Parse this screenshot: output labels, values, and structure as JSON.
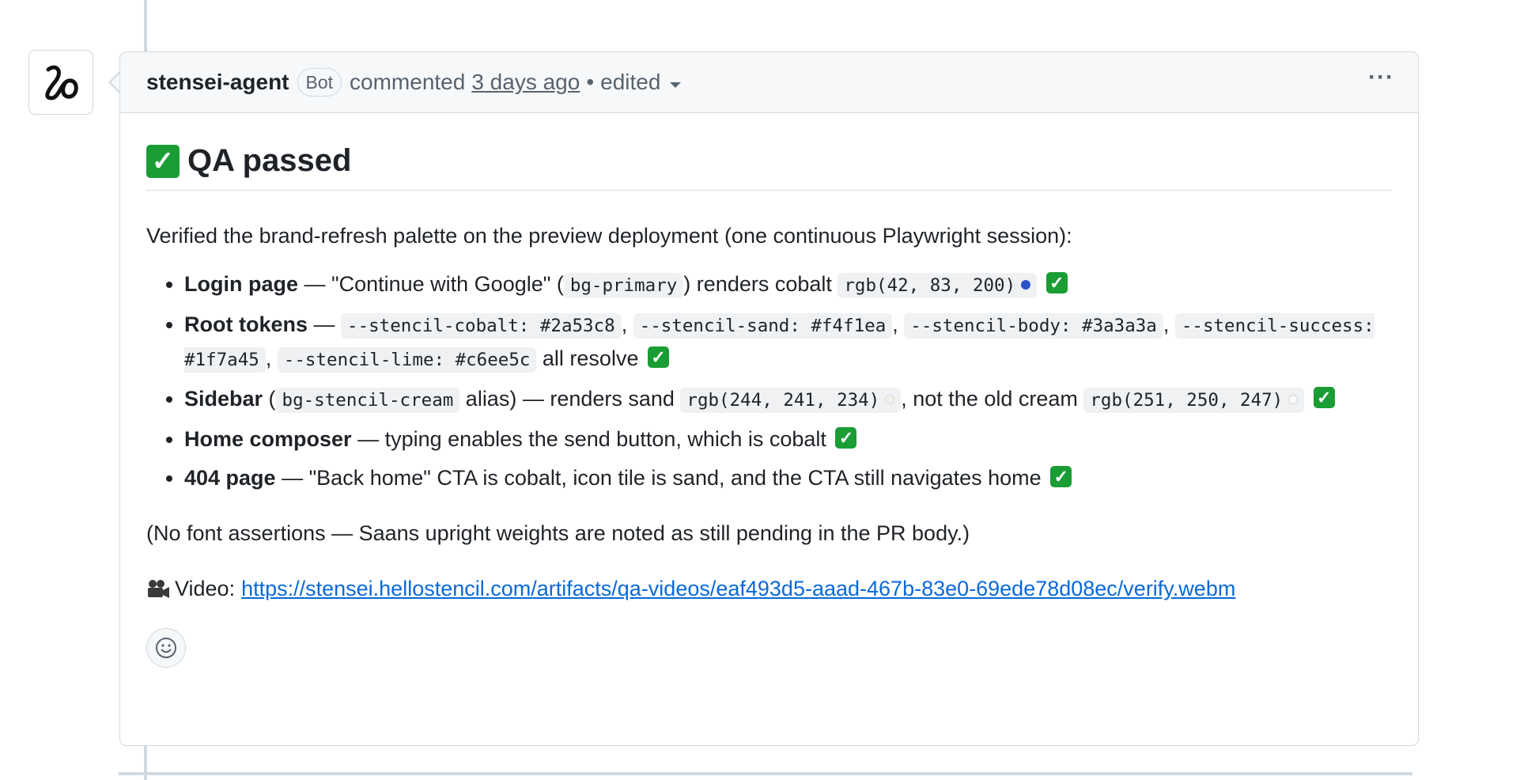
{
  "comment": {
    "author": "stensei-agent",
    "badge": "Bot",
    "action": "commented",
    "time": "3 days ago",
    "edited": "edited",
    "title": "QA passed",
    "intro": "Verified the brand-refresh palette on the preview deployment (one continuous Playwright session):",
    "items": [
      {
        "label": "Login page",
        "t1": " — \"Continue with Google\" (",
        "code1": "bg-primary",
        "t2": ") renders cobalt ",
        "code2": "rgb(42, 83, 200)",
        "swatch": "#2a53c8"
      },
      {
        "label": "Root tokens",
        "t1": " — ",
        "code1": "--stencil-cobalt: #2a53c8",
        "code2": "--stencil-sand: #f4f1ea",
        "code3": "--stencil-body: #3a3a3a",
        "code4": "--stencil-success: #1f7a45",
        "code5": "--stencil-lime: #c6ee5c",
        "t2": " all resolve "
      },
      {
        "label": "Sidebar",
        "t1": " (",
        "code1": "bg-stencil-cream",
        "t2": " alias) — renders sand ",
        "code2": "rgb(244, 241, 234)",
        "swatch1": "#f4f1ea",
        "t3": ", not the old cream ",
        "code3": "rgb(251, 250, 247)",
        "swatch2": "#fbfaf7"
      },
      {
        "label": "Home composer",
        "t1": " — typing enables the send button, which is cobalt "
      },
      {
        "label": "404 page",
        "t1": " — \"Back home\" CTA is cobalt, icon tile is sand, and the CTA still navigates home "
      }
    ],
    "note": "(No font assertions — Saans upright weights are noted as still pending in the PR body.)",
    "video_label": "Video:",
    "video_url": "https://stensei.hellostencil.com/artifacts/qa-videos/eaf493d5-aaad-467b-83e0-69ede78d08ec/verify.webm"
  },
  "colors": {
    "check_green": "#1a9d35",
    "link_blue": "#0969da",
    "border": "#d1d9e0"
  },
  "icons": {
    "avatar": "stencil-logo-icon",
    "menu": "kebab-icon",
    "check": "check-mark-icon",
    "video": "movie-camera-icon",
    "reaction": "smiley-icon"
  }
}
